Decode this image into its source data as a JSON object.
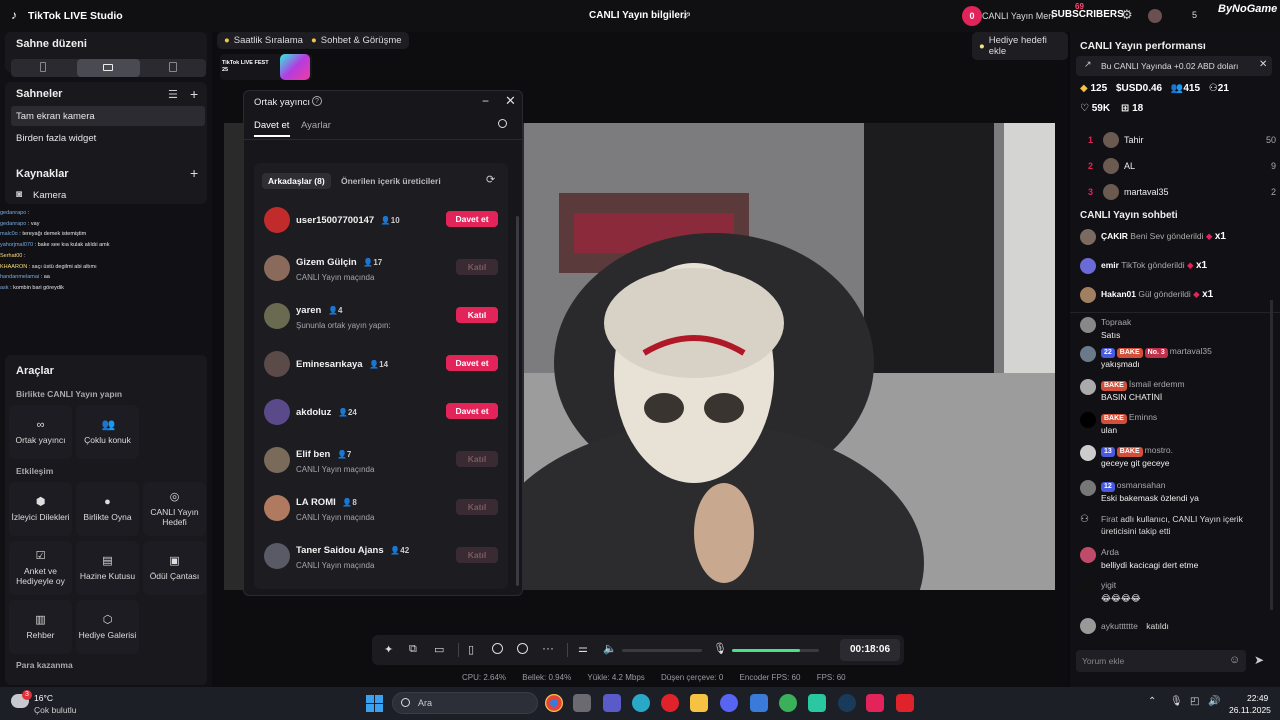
{
  "app_title": "TikTok LIVE Studio",
  "window_title": "CANLI Yayın bilgileri",
  "top_right": {
    "notif_count": "0",
    "live_center": "CANLI Yayın Merkezi",
    "subscribers": "SUBSCRIBERS",
    "badge_num": "69",
    "count": "5",
    "channel": "ByNoGame"
  },
  "left": {
    "scene_title": "Sahne düzeni",
    "scenes_title": "Sahneler",
    "scene_items": [
      "Tam ekran kamera",
      "Birden fazla widget"
    ],
    "sources_title": "Kaynaklar",
    "source_items": [
      "Kamera"
    ],
    "chat_overlay": [
      {
        "user": "gedanrapo",
        "text": ":"
      },
      {
        "user": "gedanrapo",
        "text": ": vay"
      },
      {
        "user": "malc0o",
        "text": ": tereyağı demek istemiştim"
      },
      {
        "user": "yahorjmal070",
        "text": ": bake see kıa kulak alıldıi amk"
      },
      {
        "user": "Serhat00",
        "text": ":"
      },
      {
        "user": "KHAARON",
        "text": ": saçı üstü degilmi abi altımı"
      },
      {
        "user": "handanmelamai",
        "text": ": aa"
      },
      {
        "user": "ask",
        "text": ": kombin bari göreydik"
      }
    ],
    "tools_title": "Araçlar",
    "group1": "Birlikte CANLI Yayın yapın",
    "tools1": [
      "Ortak yayıncı",
      "Çoklu konuk"
    ],
    "group2": "Etkileşim",
    "tools2": [
      "İzleyici Dilekleri",
      "Birlikte Oyna",
      "CANLI Yayın Hedefi",
      "Anket ve Hediyeyle oy",
      "Hazine Kutusu",
      "Ödül Çantası",
      "Rehber",
      "Hediye Galerisi"
    ],
    "group3": "Para kazanma"
  },
  "center": {
    "chips": [
      "Saatlik Sıralama",
      "Sohbet & Görüşme"
    ],
    "gift_goal": "Hediye hedefi ekle",
    "event_banner": "TikTok LIVE FEST 25",
    "timer": "00:18:06",
    "stats": [
      "CPU: 2.64%",
      "Bellek: 0.94%",
      "Yükle: 4.2 Mbps",
      "Düşen çerçeve: 0",
      "Encoder FPS: 60",
      "FPS: 60"
    ],
    "audio_level": 0.78
  },
  "modal": {
    "title": "Ortak yayıncı",
    "tabs": [
      "Davet et",
      "Ayarlar"
    ],
    "subtabs": [
      "Arkadaşlar (8)",
      "Önerilen içerik üreticileri"
    ],
    "users": [
      {
        "name": "user15007700147",
        "count": "10",
        "sub": "",
        "btn": "Davet et",
        "style": "red",
        "color": "#c22b2b"
      },
      {
        "name": "Gizem Gülçin",
        "count": "17",
        "sub": "CANLI Yayın maçında",
        "btn": "Katıl",
        "style": "dis",
        "color": "#8a6a5a"
      },
      {
        "name": "yaren",
        "count": "4",
        "sub": "Şununla ortak yayın yapın:",
        "btn": "Katıl",
        "style": "red2",
        "color": "#6a6a50"
      },
      {
        "name": "Eminesarıkaya",
        "count": "14",
        "sub": "",
        "btn": "Davet et",
        "style": "red",
        "color": "#5a4a48"
      },
      {
        "name": "akdoluz",
        "count": "24",
        "sub": "",
        "btn": "Davet et",
        "style": "red",
        "color": "#5b4a8a"
      },
      {
        "name": "Elif ben",
        "count": "7",
        "sub": "CANLI Yayın maçında",
        "btn": "Katıl",
        "style": "dis",
        "color": "#7a6a5a"
      },
      {
        "name": "LA ROMI",
        "count": "8",
        "sub": "CANLI Yayın maçında",
        "btn": "Katıl",
        "style": "dis",
        "color": "#b07a60"
      },
      {
        "name": "Taner Saidou Ajans",
        "count": "42",
        "sub": "CANLI Yayın maçında",
        "btn": "Katıl",
        "style": "dis",
        "color": "#5a5a66"
      }
    ]
  },
  "right": {
    "perf_title": "CANLI Yayın performansı",
    "earn_banner": "Bu CANLI Yayında +0.02 ABD doları",
    "stats": [
      "125",
      "USD0.46",
      "415",
      "21",
      "59K",
      "18"
    ],
    "ranking": [
      {
        "rank": "1",
        "name": "Tahir",
        "score": "50"
      },
      {
        "rank": "2",
        "name": "AL",
        "score": "9"
      },
      {
        "rank": "3",
        "name": "martaval35",
        "score": "2"
      }
    ],
    "chat_title": "CANLI Yayın sohbeti",
    "gifts": [
      {
        "user": "ÇAKIR",
        "text": "Beni Sev gönderildi",
        "mult": "x1"
      },
      {
        "user": "emir",
        "text": "TikTok gönderildi",
        "mult": "x1"
      },
      {
        "user": "Hakan01",
        "text": "Gül gönderildi",
        "mult": "x1"
      }
    ],
    "messages": [
      {
        "user": "Topraak",
        "text": "Satıs",
        "badges": []
      },
      {
        "user": "martaval35",
        "text": "yakışmadı",
        "badges": [
          "22",
          "BAKE",
          "No. 3"
        ]
      },
      {
        "user": "İsmail erdemm",
        "text": "BASIN CHATİNİ",
        "badges": [
          "BAKE"
        ]
      },
      {
        "user": "Eminns",
        "text": "ulan",
        "badges": [
          "BAKE"
        ]
      },
      {
        "user": "mostro.",
        "text": "geceye git geceye",
        "badges": [
          "13",
          "BAKE"
        ]
      },
      {
        "user": "osmansahan",
        "text": "Eski bakemask özlendi ya",
        "badges": [
          "12"
        ]
      },
      {
        "user": "Firat",
        "text": "adlı kullanıcı, CANLI Yayın içerik üreticisini takip etti",
        "badges": []
      },
      {
        "user": "Arda",
        "text": "belliydi kacicagi dert etme",
        "badges": []
      },
      {
        "user": "yigit",
        "text": "😂😂😂😂",
        "badges": []
      },
      {
        "user": "aykutttttte",
        "text": "katıldı",
        "badges": []
      }
    ],
    "comment_placeholder": "Yorum ekle"
  },
  "taskbar": {
    "weather_temp": "16°C",
    "weather_desc": "Çok bulutlu",
    "weather_badge": "3",
    "search": "Ara",
    "time": "22:49",
    "date": "26.11.2025"
  },
  "colors": {
    "accent": "#e3245a",
    "bg": "#111115",
    "panel": "#16161b"
  }
}
